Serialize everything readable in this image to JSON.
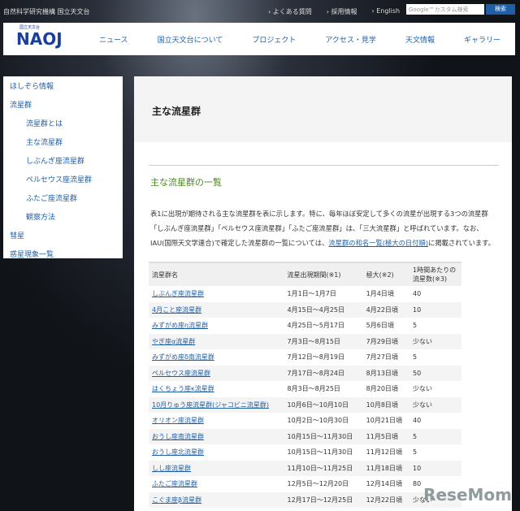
{
  "topbar": {
    "org": "自然科学研究機構 国立天文台",
    "links": [
      "› よくある質問",
      "› 採用情報",
      "› English"
    ],
    "search_placeholder": "Google™カスタム検索",
    "search_button": "検索"
  },
  "header": {
    "logo": "NAOJ",
    "logo_sub": "国立天文台",
    "nav": [
      "ニュース",
      "国立天文台について",
      "プロジェクト",
      "アクセス・見学",
      "天文情報",
      "ギャラリー"
    ]
  },
  "sidebar": {
    "items": [
      {
        "label": "ほしぞら情報",
        "sub": false
      },
      {
        "label": "流星群",
        "sub": false
      },
      {
        "label": "流星群とは",
        "sub": true
      },
      {
        "label": "主な流星群",
        "sub": true
      },
      {
        "label": "しぶんぎ座流星群",
        "sub": true
      },
      {
        "label": "ペルセウス座流星群",
        "sub": true
      },
      {
        "label": "ふたご座流星群",
        "sub": true
      },
      {
        "label": "観察方法",
        "sub": true
      },
      {
        "label": "彗星",
        "sub": false
      },
      {
        "label": "惑星現象一覧",
        "sub": false
      }
    ]
  },
  "main": {
    "title": "主な流星群",
    "heading": "主な流星群の一覧",
    "para_1": "表1に出現が期待される主な流星群を表に示します。特に、毎年ほぼ安定して多くの流星が出現する3つの流星群「しぶんぎ座流星群」「ペルセウス座流星群」「ふたご座流星群」は、「三大流星群」と呼ばれています。なお、IAU(国際天文学連合)で確定した流星群の一覧については、",
    "para_link": "流星群の和名一覧(極大の日付順)",
    "para_2": "に掲載されています。",
    "table": {
      "headers": [
        "流星群名",
        "流星出現期間(※1)",
        "極大(※2)",
        "1時間あたりの流星数(※3)"
      ],
      "rows": [
        [
          "しぶんぎ座流星群",
          "1月1日～1月7日",
          "1月4日頃",
          "40"
        ],
        [
          "4月こと座流星群",
          "4月15日～4月25日",
          "4月22日頃",
          "10"
        ],
        [
          "みずがめ座η流星群",
          "4月25日～5月17日",
          "5月6日頃",
          "5"
        ],
        [
          "やぎ座α流星群",
          "7月3日～8月15日",
          "7月29日頃",
          "少ない"
        ],
        [
          "みずがめ座δ南流星群",
          "7月12日～8月19日",
          "7月27日頃",
          "5"
        ],
        [
          "ペルセウス座流星群",
          "7月17日～8月24日",
          "8月13日頃",
          "50"
        ],
        [
          "はくちょう座κ流星群",
          "8月3日～8月25日",
          "8月20日頃",
          "少ない"
        ],
        [
          "10月りゅう座流星群(ジャコビニ流星群)",
          "10月6日～10月10日",
          "10月8日頃",
          "少ない"
        ],
        [
          "オリオン座流星群",
          "10月2日～10月30日",
          "10月21日頃",
          "40"
        ],
        [
          "おうし座南流星群",
          "10月15日～11月30日",
          "11月5日頃",
          "5"
        ],
        [
          "おうし座北流星群",
          "10月15日～11月30日",
          "11月12日頃",
          "5"
        ],
        [
          "しし座流星群",
          "11月10日～11月25日",
          "11月18日頃",
          "10"
        ],
        [
          "ふたご座流星群",
          "12月5日～12月20日",
          "12月14日頃",
          "80"
        ],
        [
          "こぐま座β流星群",
          "12月17日～12月25日",
          "12月22日頃",
          "少ない"
        ]
      ]
    }
  },
  "watermark": "ReseMom"
}
